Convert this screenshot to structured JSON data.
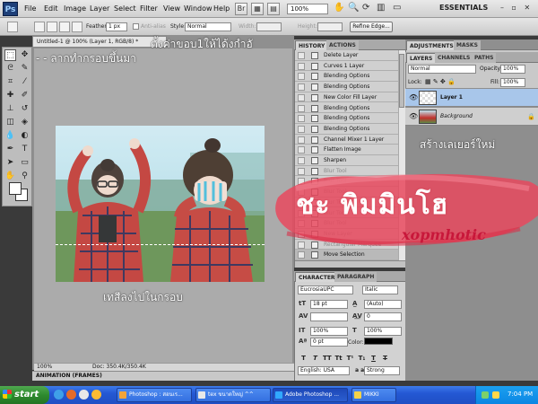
{
  "menubar": {
    "logo": "Ps",
    "items": [
      "File",
      "Edit",
      "Image",
      "Layer",
      "Select",
      "Filter",
      "View",
      "Window",
      "Help"
    ],
    "zoom": "100%",
    "workspace": "ESSENTIALS"
  },
  "options": {
    "feather_label": "Feather:",
    "feather_value": "1 px",
    "antialias_label": "Anti-alias",
    "style_label": "Style:",
    "style_value": "Normal",
    "width_label": "Width:",
    "height_label": "Height:",
    "refine_edge": "Refine Edge..."
  },
  "document": {
    "tab_title": "Untitled-1 @ 100% (Layer 1, RGB/8) *",
    "zoom": "100%",
    "doc_info": "Doc: 350.4K/350.4K",
    "animation_label": "ANIMATION (FRAMES)"
  },
  "annotations": {
    "top": "ตั้งค่าขอบ1ให้ได้งกำอั",
    "drag": "- - ลากทำกรอบขึ้นมา",
    "fill": "เทสีลงไปในกรอบ",
    "new_layer": "สร้างเลเยอร์ใหม่"
  },
  "watermark": {
    "thai": "ชะ พิมมินโฮ",
    "latin": "xopmhotic",
    "smear_color": "#e8495e"
  },
  "history": {
    "tabs": [
      "HISTORY",
      "ACTIONS"
    ],
    "items": [
      {
        "label": "Delete Layer",
        "state": "normal"
      },
      {
        "label": "Curves 1 Layer",
        "state": "normal"
      },
      {
        "label": "Blending Options",
        "state": "normal"
      },
      {
        "label": "Blending Options",
        "state": "normal"
      },
      {
        "label": "New Color Fill Layer",
        "state": "normal"
      },
      {
        "label": "Blending Options",
        "state": "normal"
      },
      {
        "label": "Blending Options",
        "state": "normal"
      },
      {
        "label": "Blending Options",
        "state": "normal"
      },
      {
        "label": "Channel Mixer 1 Layer",
        "state": "normal"
      },
      {
        "label": "Flatten Image",
        "state": "normal"
      },
      {
        "label": "Sharpen",
        "state": "normal"
      },
      {
        "label": "Blur Tool",
        "state": "undone"
      },
      {
        "label": "Blur Tool",
        "state": "undone"
      },
      {
        "label": "Blur Tool",
        "state": "undone"
      },
      {
        "label": "Blur Tool",
        "state": "undone"
      },
      {
        "label": "Blur Tool",
        "state": "undone"
      },
      {
        "label": "Blur Tool",
        "state": "undone"
      },
      {
        "label": "New Layer",
        "state": "undone"
      },
      {
        "label": "Rectangular Marquee",
        "state": "undone"
      },
      {
        "label": "Move Selection",
        "state": "current"
      }
    ]
  },
  "character": {
    "tabs": [
      "CHARACTER",
      "PARAGRAPH"
    ],
    "font_family": "EucrosiaUPC",
    "font_style": "Italic",
    "font_size": "18 pt",
    "leading": "(Auto)",
    "kerning": "",
    "tracking": "0",
    "vertical_scale": "100%",
    "horizontal_scale": "100%",
    "baseline_shift": "0 pt",
    "color_label": "Color:",
    "style_buttons": [
      "T",
      "T",
      "TT",
      "Tt",
      "T¹",
      "T₁",
      "T",
      "T"
    ],
    "language": "English: USA",
    "aa_prefix": "a a",
    "antialias": "Strong"
  },
  "right_panels": {
    "top_tabs": [
      "ADJUSTMENTS",
      "MASKS"
    ],
    "layer_tabs": [
      "LAYERS",
      "CHANNELS",
      "PATHS"
    ],
    "blend_mode": "Normal",
    "opacity_label": "Opacity:",
    "opacity": "100%",
    "lock_label": "Lock:",
    "fill_label": "Fill:",
    "fill": "100%",
    "layers": [
      {
        "name": "Layer 1",
        "selected": true,
        "italic": false
      },
      {
        "name": "Background",
        "selected": false,
        "italic": true
      }
    ]
  },
  "taskbar": {
    "start": "start",
    "tasks": [
      {
        "label": "Photoshop : สอนเร...",
        "active": false,
        "icon_color": "#f2a43a"
      },
      {
        "label": "tex ขนาดใหญ่ ^^",
        "active": false,
        "icon_color": "#e8e8e8"
      },
      {
        "label": "Adobe Photoshop ...",
        "active": true,
        "icon_color": "#31a8ff"
      },
      {
        "label": "MIKKI",
        "active": false,
        "icon_color": "#f4d24a"
      }
    ],
    "clock": "7:04 PM"
  },
  "colors": {
    "ps_blue": "#1e3f78",
    "selected_layer": "#a8c6ea",
    "taskbar": "#2458d4"
  }
}
